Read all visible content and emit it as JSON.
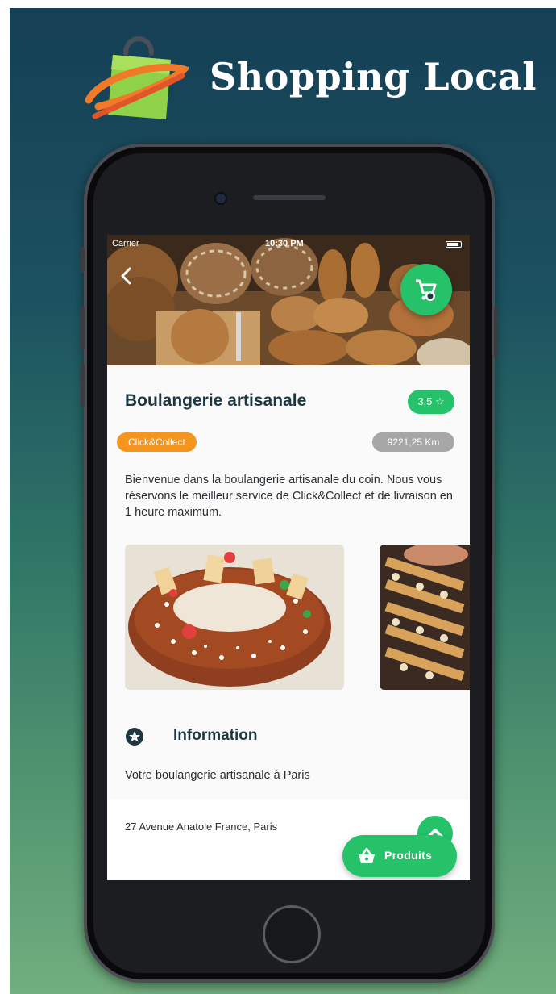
{
  "brand": {
    "title": "Shopping Local"
  },
  "status_bar": {
    "carrier": "Carrier",
    "time": "10:30 PM"
  },
  "store": {
    "name": "Boulangerie artisanale",
    "rating": "3,5 ☆",
    "tag": "Click&Collect",
    "distance": "9221,25 Km",
    "description": "Bienvenue dans la boulangerie artisanale du coin. Nous vous réservons le meilleur service de Click&Collect et de livraison en 1 heure maximum."
  },
  "information": {
    "title": "Information",
    "text": "Votre boulangerie artisanale à Paris",
    "address": "27 Avenue Anatole France, Paris"
  },
  "actions": {
    "produits_label": "Produits"
  },
  "icons": {
    "back": "chevron-left-icon",
    "cart": "cart-icon",
    "info": "star-circle-icon",
    "up": "chevron-up-icon",
    "basket": "basket-icon"
  },
  "colors": {
    "accent_green": "#25c26a",
    "tag_orange": "#f5951f",
    "tag_grey": "#a7a7a7",
    "title_dark": "#1e3640",
    "background_top": "#153f55",
    "background_bottom": "#72ae7e"
  }
}
